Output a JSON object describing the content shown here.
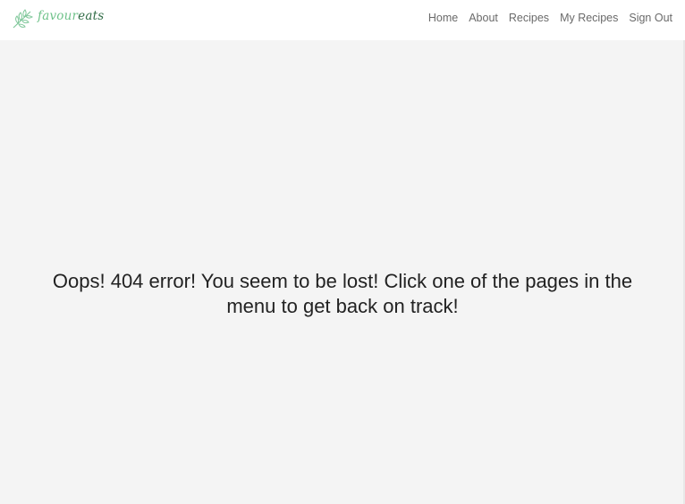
{
  "brand": {
    "name_part_a": "favour",
    "name_part_b": "eats",
    "icon": "herb-leaf-icon",
    "accent_color": "#6fc28a",
    "dark_color": "#2f6b45"
  },
  "nav": {
    "items": [
      {
        "label": "Home"
      },
      {
        "label": "About"
      },
      {
        "label": "Recipes"
      },
      {
        "label": "My Recipes"
      },
      {
        "label": "Sign Out"
      }
    ]
  },
  "main": {
    "error_message": "Oops! 404 error! You seem to be lost! Click one of the pages in the menu to get back on track!"
  }
}
